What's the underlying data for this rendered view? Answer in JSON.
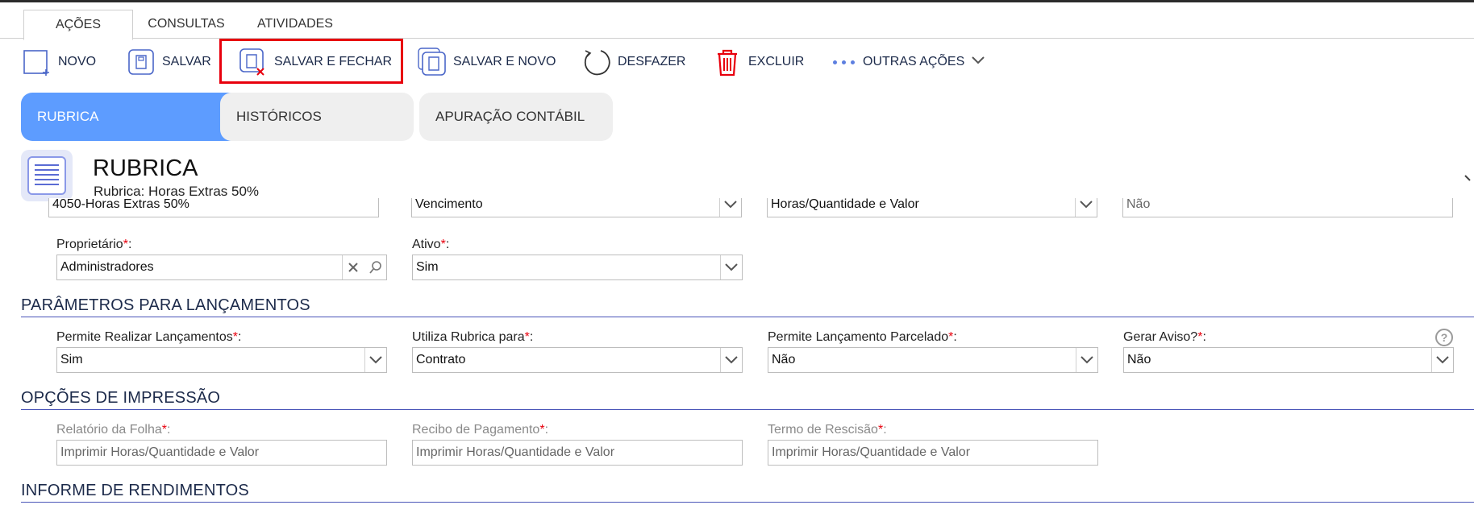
{
  "ribbon": {
    "tabs": [
      "AÇÕES",
      "CONSULTAS",
      "ATIVIDADES"
    ]
  },
  "toolbar": {
    "novo": "NOVO",
    "salvar": "SALVAR",
    "salvar_fechar": "SALVAR E FECHAR",
    "salvar_novo": "SALVAR E NOVO",
    "desfazer": "DESFAZER",
    "excluir": "EXCLUIR",
    "outras": "OUTRAS AÇÕES"
  },
  "section_tabs": [
    "RUBRICA",
    "HISTÓRICOS",
    "APURAÇÃO CONTÁBIL"
  ],
  "header": {
    "title": "RUBRICA",
    "subtitle": "Rubrica: Horas Extras 50%"
  },
  "clipped_row": [
    "4050-Horas Extras 50%",
    "Vencimento",
    "Horas/Quantidade e Valor",
    "Não"
  ],
  "fields": {
    "proprietario": {
      "label": "Proprietário",
      "value": "Administradores"
    },
    "ativo": {
      "label": "Ativo",
      "value": "Sim"
    }
  },
  "sections": {
    "parametros": "PARÂMETROS PARA LANÇAMENTOS",
    "impressao": "OPÇÕES DE IMPRESSÃO",
    "rendimentos": "INFORME DE RENDIMENTOS"
  },
  "parametros": {
    "permite_lancamentos": {
      "label": "Permite Realizar Lançamentos",
      "value": "Sim"
    },
    "utiliza_rubrica": {
      "label": "Utiliza Rubrica para",
      "value": "Contrato"
    },
    "lancamento_parcelado": {
      "label": "Permite Lançamento Parcelado",
      "value": "Não"
    },
    "gerar_aviso": {
      "label": "Gerar Aviso?",
      "value": "Não"
    }
  },
  "impressao": {
    "relatorio_folha": {
      "label": "Relatório da Folha",
      "value": "Imprimir Horas/Quantidade e Valor"
    },
    "recibo_pagamento": {
      "label": "Recibo de Pagamento",
      "value": "Imprimir Horas/Quantidade e Valor"
    },
    "termo_rescisao": {
      "label": "Termo de Rescisão",
      "value": "Imprimir Horas/Quantidade e Valor"
    }
  },
  "required_mark": "*",
  "help_glyph": "?",
  "colors": {
    "accent": "#5d9cff",
    "highlight": "#e8000d",
    "section_line": "#4a55b8",
    "delete": "#e8000d"
  }
}
